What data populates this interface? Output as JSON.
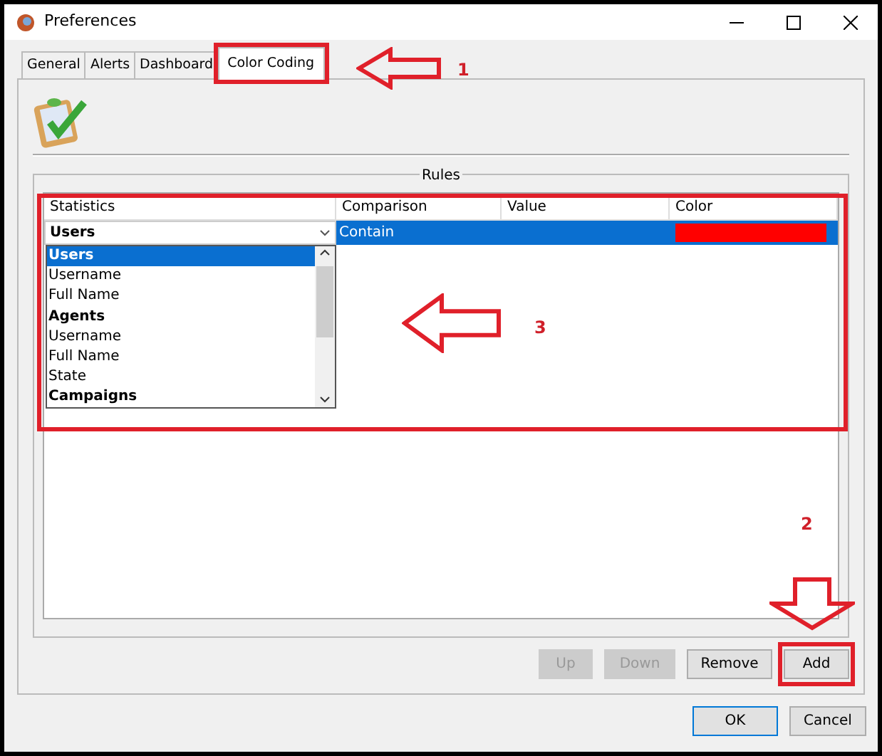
{
  "window": {
    "title": "Preferences"
  },
  "tabs": [
    {
      "label": "General",
      "selected": false
    },
    {
      "label": "Alerts",
      "selected": false
    },
    {
      "label": "Dashboard",
      "selected": false
    },
    {
      "label": "Color Coding",
      "selected": true
    }
  ],
  "rules": {
    "title": "Rules",
    "columns": [
      "Statistics",
      "Comparison",
      "Value",
      "Color"
    ],
    "rows": [
      {
        "statistics": "Users",
        "comparison": "Contain",
        "color": "#ff0000",
        "selected": true
      }
    ],
    "dropdown": [
      {
        "label": "Users",
        "kind": "group",
        "selected": true
      },
      {
        "label": "Username",
        "kind": "item",
        "selected": false
      },
      {
        "label": "Full Name",
        "kind": "item",
        "selected": false
      },
      {
        "label": "Agents",
        "kind": "group",
        "selected": false
      },
      {
        "label": "Username",
        "kind": "item",
        "selected": false
      },
      {
        "label": "Full Name",
        "kind": "item",
        "selected": false
      },
      {
        "label": "State",
        "kind": "item",
        "selected": false
      },
      {
        "label": "Campaigns",
        "kind": "group",
        "selected": false
      }
    ]
  },
  "buttons": [
    {
      "label": "Up",
      "disabled": true
    },
    {
      "label": "Down",
      "disabled": true
    },
    {
      "label": "Remove",
      "disabled": false
    },
    {
      "label": "Add",
      "disabled": false
    }
  ],
  "dialog_buttons": [
    {
      "label": "OK",
      "default": true
    },
    {
      "label": "Cancel",
      "default": false
    }
  ],
  "annotations": [
    {
      "label": "1",
      "kind": "leftarrow"
    },
    {
      "label": "2",
      "kind": "downarrow"
    },
    {
      "label": "3",
      "kind": "leftarrow"
    }
  ]
}
